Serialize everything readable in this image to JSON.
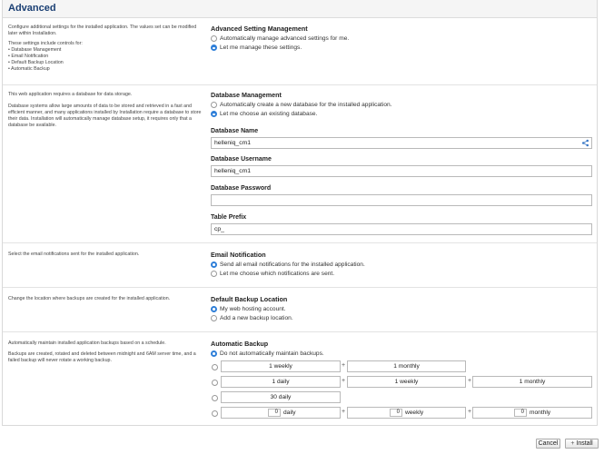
{
  "panel": {
    "title": "Advanced"
  },
  "advanced": {
    "description": "Configure additional settings for the installed application. The values set can be modified later within Installation.",
    "controls_intro": "These settings include controls for:",
    "controls": [
      "Database Management",
      "Email Notification",
      "Default Backup Location",
      "Automatic Backup"
    ],
    "title": "Advanced Setting Management",
    "options": [
      {
        "label": "Automatically manage advanced settings for me.",
        "checked": false
      },
      {
        "label": "Let me manage these settings.",
        "checked": true
      }
    ]
  },
  "database": {
    "description_1": "This web application requires a database for data storage.",
    "description_2": "Database systems allow large amounts of data to be stored and retrieved in a fast and efficient manner, and many applications installed by Installation require a database to store their data. Installation will automatically manage database setup, it requires only that a database be available.",
    "title": "Database Management",
    "options": [
      {
        "label": "Automatically create a new database for the installed application.",
        "checked": false
      },
      {
        "label": "Let me choose an existing database.",
        "checked": true
      }
    ],
    "name_label": "Database Name",
    "name_value": "helleniq_cm1",
    "username_label": "Database Username",
    "username_value": "helleniq_cm1",
    "password_label": "Database Password",
    "password_value": "",
    "prefix_label": "Table Prefix",
    "prefix_value": "cp_"
  },
  "email": {
    "description": "Select the email notifications sent for the installed application.",
    "title": "Email Notification",
    "options": [
      {
        "label": "Send all email notifications for the installed application.",
        "checked": true
      },
      {
        "label": "Let me choose which notifications are sent.",
        "checked": false
      }
    ]
  },
  "backup_location": {
    "description": "Change the location where backups are created for the installed application.",
    "title": "Default Backup Location",
    "options": [
      {
        "label": "My web hosting account.",
        "checked": true
      },
      {
        "label": "Add a new backup location.",
        "checked": false
      }
    ]
  },
  "auto_backup": {
    "description_1": "Automatically maintain installed application backups based on a schedule.",
    "description_2": "Backups are created, rotated and deleted between midnight and 6AM server time, and a failed backup will never rotate a working backup.",
    "title": "Automatic Backup",
    "no_backup_label": "Do not automatically maintain backups.",
    "plus": "+",
    "row1": [
      "1 weekly",
      "1 monthly"
    ],
    "row2": [
      "1 daily",
      "1 weekly",
      "1 monthly"
    ],
    "row3": [
      "30 daily"
    ],
    "custom": {
      "daily_value": "0",
      "daily_label": "daily",
      "weekly_value": "0",
      "weekly_label": "weekly",
      "monthly_value": "0",
      "monthly_label": "monthly"
    }
  },
  "footer": {
    "cancel": "Cancel",
    "install": "Install",
    "install_icon": "plus-icon"
  },
  "colors": {
    "accent": "#2f7fd8",
    "title": "#1a3f73"
  }
}
